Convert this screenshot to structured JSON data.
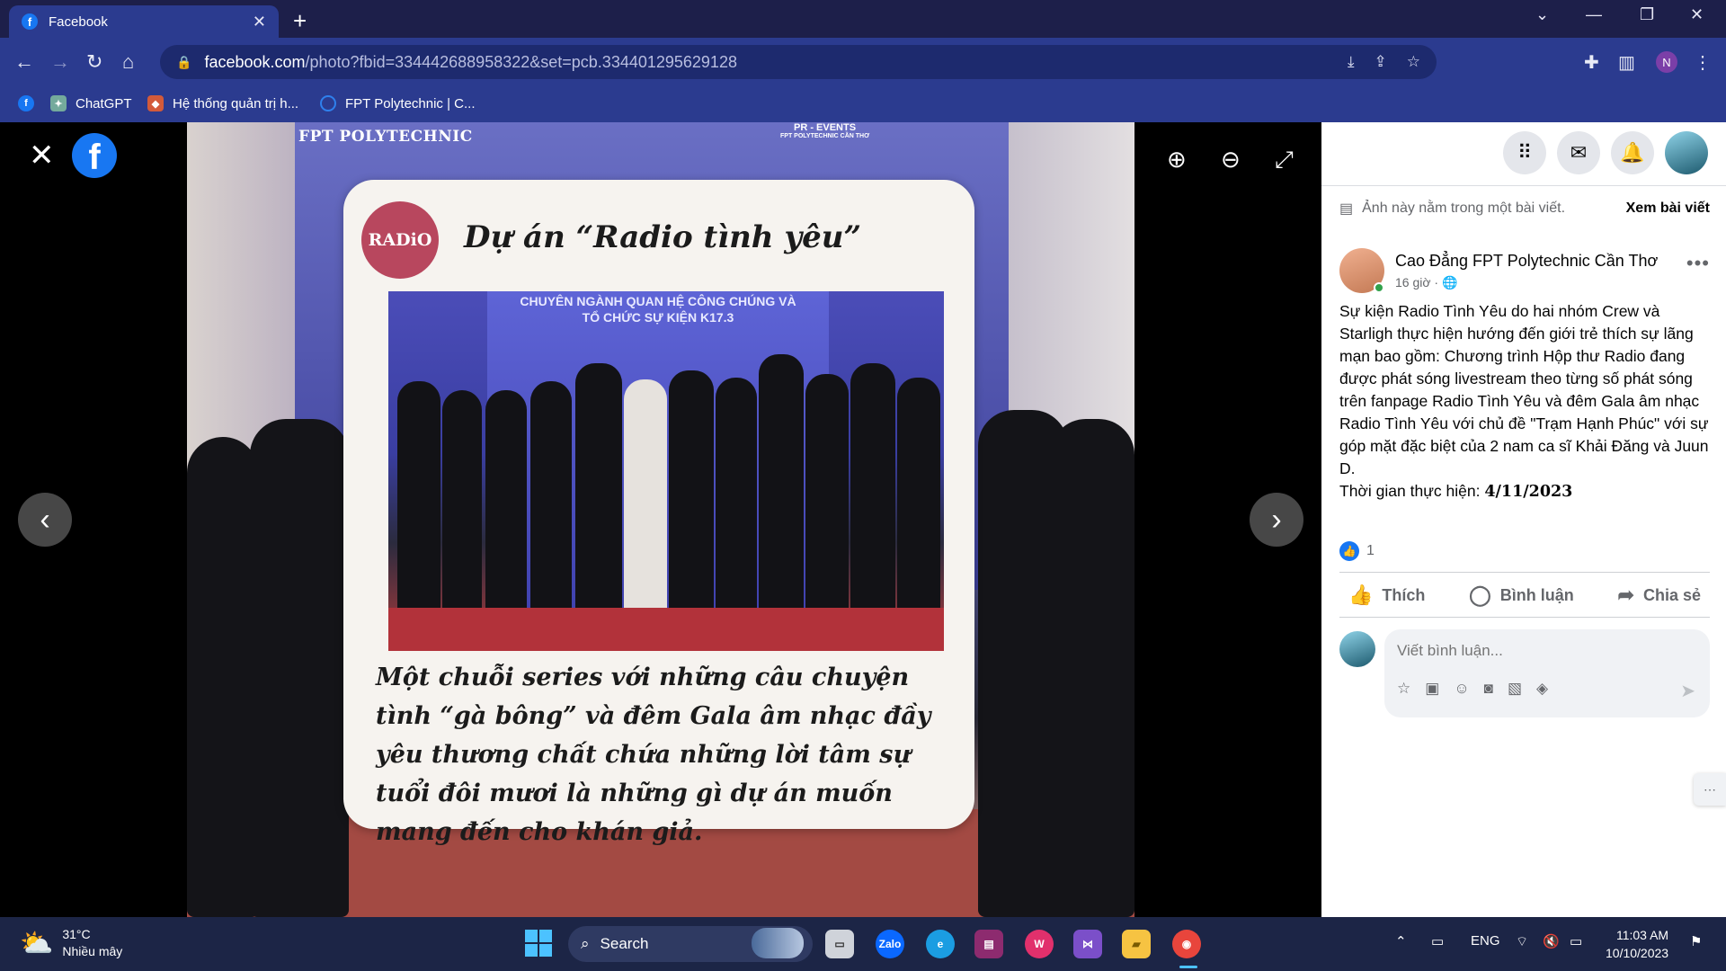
{
  "browser": {
    "tab_title": "Facebook",
    "url_host": "facebook.com",
    "url_path": "/photo?fbid=334442688958322&set=pcb.334401295629128",
    "bookmarks": [
      "ChatGPT",
      "Hệ thống quản trị h...",
      "FPT Polytechnic | C..."
    ]
  },
  "photo": {
    "brand_left": "FPT POLYTECHNIC",
    "brand_right": "PR - EVENTS",
    "brand_right_sub": "FPT POLYTECHNIC CẦN THƠ",
    "card_logo": "RADiO",
    "card_title": "Dự án “Radio tình yêu”",
    "inner_banner": "CHUYÊN NGÀNH QUAN HỆ CÔNG CHÚNG VÀ TỔ CHỨC SỰ KIỆN K17.3",
    "caption": "Một chuỗi series với những câu chuyện tình “gà bông” và đêm Gala âm nhạc đầy yêu thương chất chứa những lời tâm sự tuổi đôi mươi là những gì dự án muốn mang đến cho khán giả."
  },
  "panel": {
    "post_note": "Ảnh này nằm trong một bài viết.",
    "see_post": "Xem bài viết",
    "author_name": "Cao Đẳng FPT Polytechnic Cần Thơ",
    "post_time": "16 giờ · ",
    "post_text": "Sự kiện Radio Tình Yêu do hai nhóm Crew và Starligh thực hiện hướng đến giới trẻ thích sự lãng mạn bao gồm: Chương trình Hộp thư Radio đang được phát sóng livestream theo từng số phát sóng trên fanpage Radio Tình Yêu và đêm Gala âm nhạc Radio Tình Yêu với chủ đề \"Trạm Hạnh Phúc\" với sự góp mặt đặc biệt của 2 nam ca sĩ Khải Đăng và Juun D.",
    "post_time_label": "Thời gian thực hiện: ",
    "post_date": "4/11/2023",
    "reaction_count": "1",
    "like_label": "Thích",
    "comment_label": "Bình luận",
    "share_label": "Chia sẻ",
    "comment_placeholder": "Viết bình luận..."
  },
  "taskbar": {
    "temp": "31°C",
    "weather": "Nhiều mây",
    "search_label": "Search",
    "lang": "ENG",
    "time": "11:03 AM",
    "date": "10/10/2023"
  }
}
